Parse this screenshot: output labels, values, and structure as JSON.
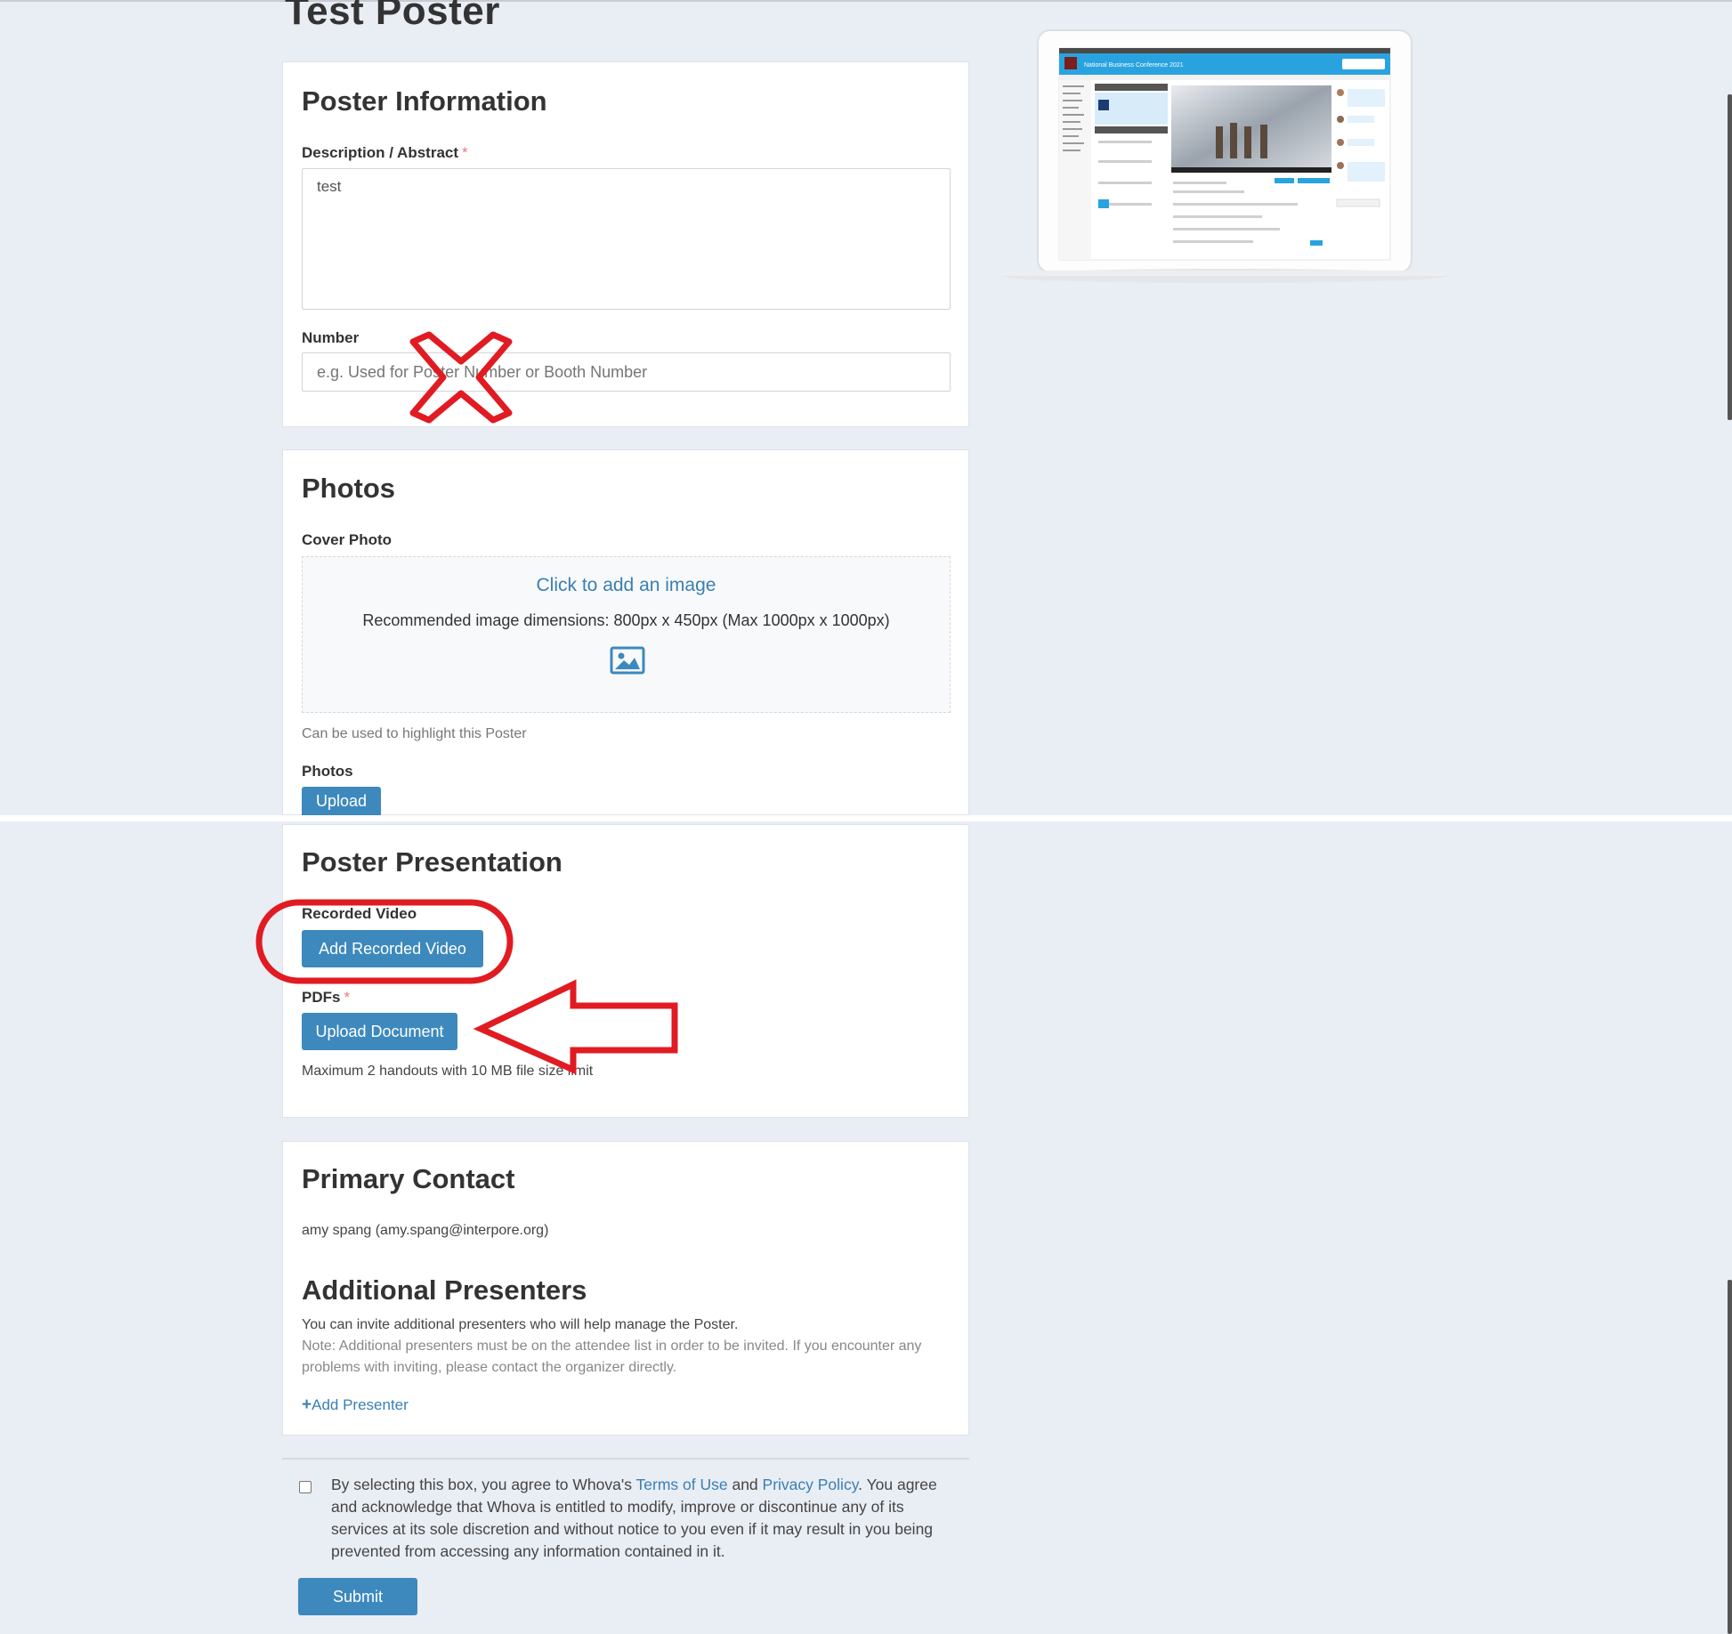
{
  "page": {
    "title": "Test Poster"
  },
  "poster_info": {
    "heading": "Poster Information",
    "description_label": "Description / Abstract",
    "required_marker": "*",
    "description_value": "test",
    "number_label": "Number",
    "number_placeholder": "e.g. Used for Poster Number or Booth Number"
  },
  "photos": {
    "heading": "Photos",
    "cover_label": "Cover Photo",
    "dropzone_link": "Click to add an image",
    "dropzone_recommend": "Recommended image dimensions: 800px x 450px (Max 1000px x 1000px)",
    "cover_hint": "Can be used to highlight this Poster",
    "photos_label": "Photos",
    "upload_button": "Upload"
  },
  "presentation": {
    "heading": "Poster Presentation",
    "video_label": "Recorded Video",
    "add_video_button": "Add Recorded Video",
    "pdfs_label": "PDFs",
    "required_marker": "*",
    "upload_doc_button": "Upload Document",
    "handouts_note": "Maximum 2 handouts with 10 MB file size limit"
  },
  "contact": {
    "heading": "Primary Contact",
    "value": "amy spang (amy.spang@interpore.org)",
    "additional_heading": "Additional Presenters",
    "invite_text": "You can invite additional presenters who will help manage the Poster.",
    "note_text": "Note: Additional presenters must be on the attendee list in order to be invited. If you encounter any problems with inviting, please contact the organizer directly.",
    "add_presenter_icon": "+",
    "add_presenter_link": "Add Presenter"
  },
  "terms": {
    "text_before": "By selecting this box, you agree to Whova's ",
    "terms_link": "Terms of Use",
    "and_text": " and ",
    "privacy_link": "Privacy Policy",
    "text_after": ". You agree and acknowledge that Whova is entitled to modify, improve or discontinue any of its services at its sole discretion and without notice to you even if it may result in you being prevented from accessing any information contained in it.",
    "submit_button": "Submit"
  },
  "preview": {
    "app_title": "National Business Conference 2021"
  },
  "icons": {
    "cover_image": "image-icon",
    "laptop_preview": "laptop-preview-icon"
  },
  "colors": {
    "accent": "#3d89bd",
    "link": "#3a7fb3",
    "annotation_red": "#e11b22",
    "background": "#e9edf4"
  }
}
